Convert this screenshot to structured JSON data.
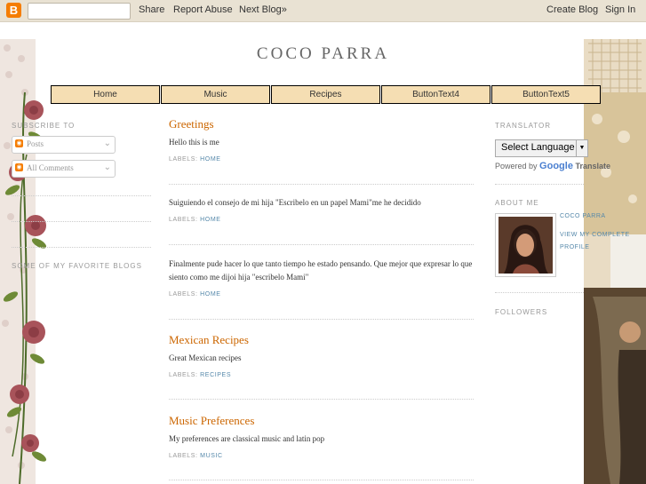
{
  "navbar": {
    "logo_letter": "B",
    "search_value": "",
    "share_label": "Share",
    "report_label": "Report Abuse",
    "next_label": "Next Blog»",
    "create_label": "Create Blog",
    "signin_label": "Sign In"
  },
  "header": {
    "title": "COCO PARRA"
  },
  "tabs": [
    {
      "label": "Home"
    },
    {
      "label": "Music"
    },
    {
      "label": "Recipes"
    },
    {
      "label": "ButtonText4"
    },
    {
      "label": "ButtonText5"
    }
  ],
  "left_sidebar": {
    "subscribe_heading": "SUBSCRIBE TO",
    "subscribe_items": [
      {
        "label": "Posts"
      },
      {
        "label": "All Comments"
      }
    ],
    "blogs_heading": "SOME OF MY FAVORITE BLOGS"
  },
  "posts": [
    {
      "title": "Greetings",
      "body": "Hello this is me",
      "labels_prefix": "LABELS:",
      "label": "HOME"
    },
    {
      "title": "",
      "body": "Suiguiendo el consejo de mi hija \"Escribelo en un papel Mami\"me he decidido",
      "labels_prefix": "LABELS:",
      "label": "HOME"
    },
    {
      "title": "",
      "body": "Finalmente pude hacer lo que tanto tiempo he estado pensando. Que mejor que expresar lo que siento como me dijoi hija \"escribelo Mami\"",
      "labels_prefix": "LABELS:",
      "label": "HOME"
    },
    {
      "title": "Mexican Recipes",
      "body": "Great Mexican recipes",
      "labels_prefix": "LABELS:",
      "label": "RECIPES"
    },
    {
      "title": "Music Preferences",
      "body": "My preferences are classical music and latin pop",
      "labels_prefix": "LABELS:",
      "label": "MUSIC"
    }
  ],
  "right_sidebar": {
    "translator_heading": "TRANSLATOR",
    "select_language_label": "Select Language",
    "powered_by": "Powered by",
    "google_word": "Google",
    "translate_word": "Translate",
    "about_heading": "ABOUT ME",
    "profile_name": "COCO PARRA",
    "profile_link": "VIEW MY COMPLETE PROFILE",
    "followers_heading": "FOLLOWERS"
  },
  "colors": {
    "accent": "#cc6600",
    "link": "#5588aa",
    "tab_bg": "#f5deb3",
    "navbar_bg": "#e9e2d3"
  }
}
